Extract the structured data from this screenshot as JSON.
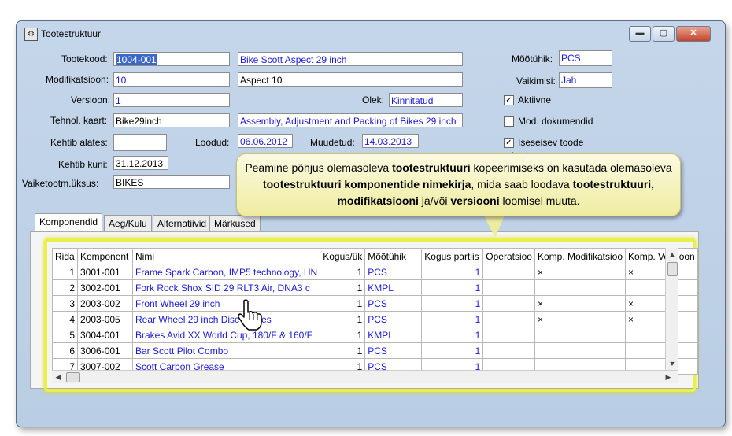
{
  "window": {
    "title": "Tootestruktuur",
    "icon": "structure-icon",
    "min": "▬",
    "max": "▢",
    "close": "✕"
  },
  "form": {
    "tootekood_label": "Tootekood:",
    "tootekood": "1004-001",
    "product_name": "Bike Scott Aspect 29 inch",
    "modifikatsioon_label": "Modifikatsioon:",
    "modifikatsioon": "10",
    "modification_name": "Aspect 10",
    "versioon_label": "Versioon:",
    "versioon": "1",
    "olek_label": "Olek:",
    "olek": "Kinnitatud",
    "tehnol_kaart_label": "Tehnol. kaart:",
    "tehnol_kaart": "Bike29inch",
    "tehnol_kaart_desc": "Assembly, Adjustment and Packing of Bikes 29 inch",
    "kehtib_alates_label": "Kehtib alates:",
    "kehtib_alates": "",
    "loodud_label": "Loodud:",
    "loodud": "06.06.2012",
    "muudetud_label": "Muudetud:",
    "muudetud": "14.03.2013",
    "kehtib_kuni_label": "Kehtib kuni:",
    "kehtib_kuni": "31.12.2013",
    "vaiketootm_label": "Vaiketootm.üksus:",
    "vaiketootm": "BIKES",
    "mootuhik_label": "Mõõtühik:",
    "mootuhik": "PCS",
    "vaikimisi_label": "Vaikimisi:",
    "vaikimisi": "Jah",
    "aktiivne_label": "Aktiivne",
    "aktiivne_checked": true,
    "mod_dok_label": "Mod. dokumendid",
    "mod_dok_checked": false,
    "iseseisev_label": "Iseseisev toode",
    "iseseisev_checked": true,
    "arvuta_label": "Arvuta"
  },
  "callout": {
    "p1": "Peamine põhjus olemasoleva ",
    "b1": "tootestruktuuri",
    "p2": " kopeerimiseks on kasutada olemasoleva ",
    "b2": "tootestruktuuri komponentide nimekirja",
    "p3": ", mida saab loodava ",
    "b3": "tootestruktuuri, modifikatsiooni",
    "p4": " ja/või ",
    "b4": "versiooni",
    "p5": " loomisel muuta."
  },
  "tabs": [
    "Komponendid",
    "Aeg/Kulu",
    "Alternatiivid",
    "Märkused"
  ],
  "grid": {
    "headers": [
      "Rida",
      "Komponent",
      "Nimi",
      "Kogus/ük",
      "Mõõtühik",
      "Kogus partiis",
      "Operatsioo",
      "Komp. Modifikatsioo",
      "Komp. Versioon"
    ],
    "rows": [
      [
        "1",
        "3001-001",
        "Frame Spark Carbon, IMP5 technology, HN",
        "1",
        "PCS",
        "1",
        "",
        "×",
        "×"
      ],
      [
        "2",
        "3002-001",
        "Fork Rock Shox SID 29 RLT3 Air, DNA3 c",
        "1",
        "KMPL",
        "1",
        "",
        "",
        ""
      ],
      [
        "3",
        "2003-002",
        "Front Wheel 29 inch",
        "1",
        "PCS",
        "1",
        "",
        "×",
        "×"
      ],
      [
        "4",
        "2003-005",
        "Rear Wheel 29 inch Disc Brakes",
        "1",
        "PCS",
        "1",
        "",
        "×",
        "×"
      ],
      [
        "5",
        "3004-001",
        "Brakes Avid XX World Cup, 180/F & 160/F",
        "1",
        "KMPL",
        "1",
        "",
        "",
        ""
      ],
      [
        "6",
        "3006-001",
        "Bar Scott Pilot Combo",
        "1",
        "PCS",
        "1",
        "",
        "",
        ""
      ],
      [
        "7",
        "3007-002",
        "Scott Carbon Grease",
        "1",
        "PCS",
        "1",
        "",
        "",
        ""
      ]
    ]
  }
}
